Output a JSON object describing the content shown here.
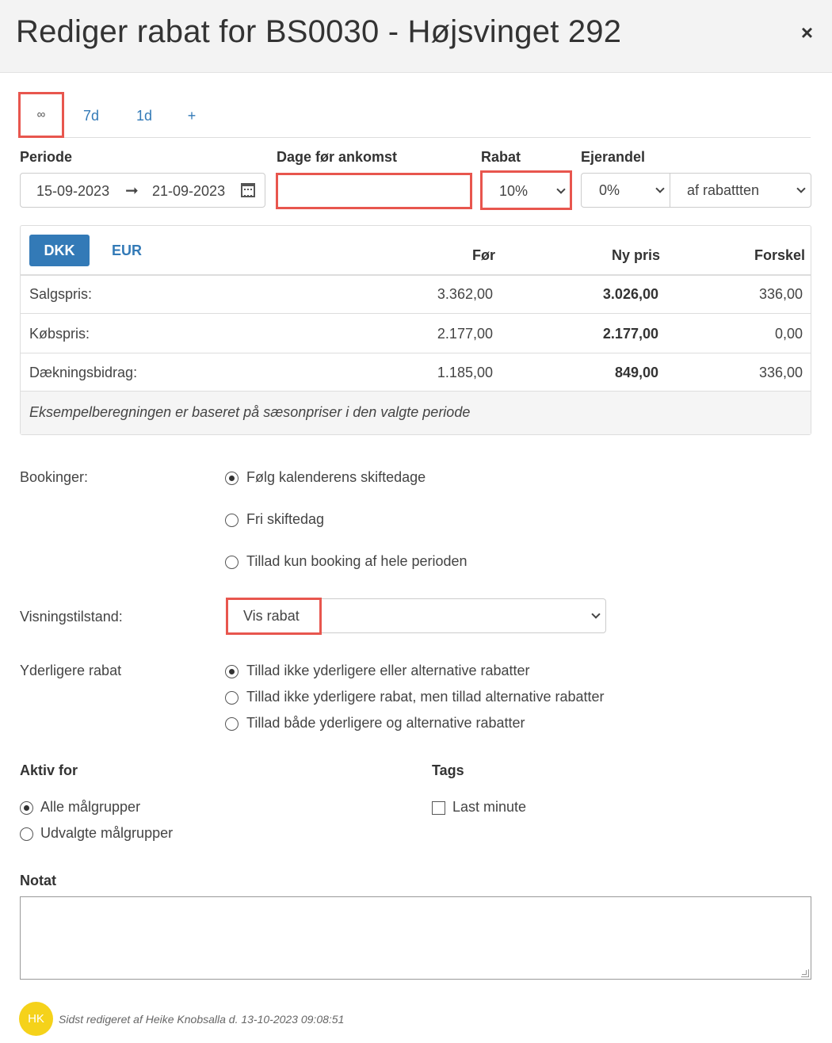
{
  "header": {
    "title": "Rediger rabat for BS0030 - Højsvinget 292",
    "close": "×"
  },
  "tabs": [
    {
      "label": "∞",
      "active": true
    },
    {
      "label": "7d",
      "active": false
    },
    {
      "label": "1d",
      "active": false
    },
    {
      "label": "+",
      "active": false
    }
  ],
  "fields": {
    "periode_label": "Periode",
    "date_from": "15-09-2023",
    "date_arrow": "➞",
    "date_to": "21-09-2023",
    "dage_label": "Dage før ankomst",
    "dage_value": "",
    "rabat_label": "Rabat",
    "rabat_value": "10%",
    "ejerandel_label": "Ejerandel",
    "ejerandel_value": "0%",
    "ejerandel_basis": "af rabattten"
  },
  "prices": {
    "currency_active": "DKK",
    "currency_other": "EUR",
    "col_before": "Før",
    "col_new": "Ny pris",
    "col_diff": "Forskel",
    "rows": [
      {
        "label": "Salgspris:",
        "before": "3.362,00",
        "new": "3.026,00",
        "diff": "336,00"
      },
      {
        "label": "Købspris:",
        "before": "2.177,00",
        "new": "2.177,00",
        "diff": "0,00"
      },
      {
        "label": "Dækningsbidrag:",
        "before": "1.185,00",
        "new": "849,00",
        "diff": "336,00"
      }
    ],
    "footnote": "Eksempelberegningen er baseret på sæsonpriser i den valgte periode"
  },
  "bookinger": {
    "label": "Bookinger:",
    "options": [
      "Følg kalenderens skiftedage",
      "Fri skiftedag",
      "Tillad kun booking af hele perioden"
    ],
    "selected": 0
  },
  "visning": {
    "label": "Visningstilstand:",
    "value": "Vis rabat"
  },
  "yderligere": {
    "label": "Yderligere rabat",
    "options": [
      "Tillad ikke yderligere eller alternative rabatter",
      "Tillad ikke yderligere rabat, men tillad alternative rabatter",
      "Tillad både yderligere og alternative rabatter"
    ],
    "selected": 0
  },
  "aktiv": {
    "label": "Aktiv for",
    "options": [
      "Alle målgrupper",
      "Udvalgte målgrupper"
    ],
    "selected": 0
  },
  "tags": {
    "label": "Tags",
    "items": [
      {
        "label": "Last minute",
        "checked": false
      }
    ]
  },
  "notat": {
    "label": "Notat",
    "value": ""
  },
  "footer": {
    "initials": "HK",
    "edited": "Sidst redigeret af Heike Knobsalla d. 13-10-2023 09:08:51"
  }
}
